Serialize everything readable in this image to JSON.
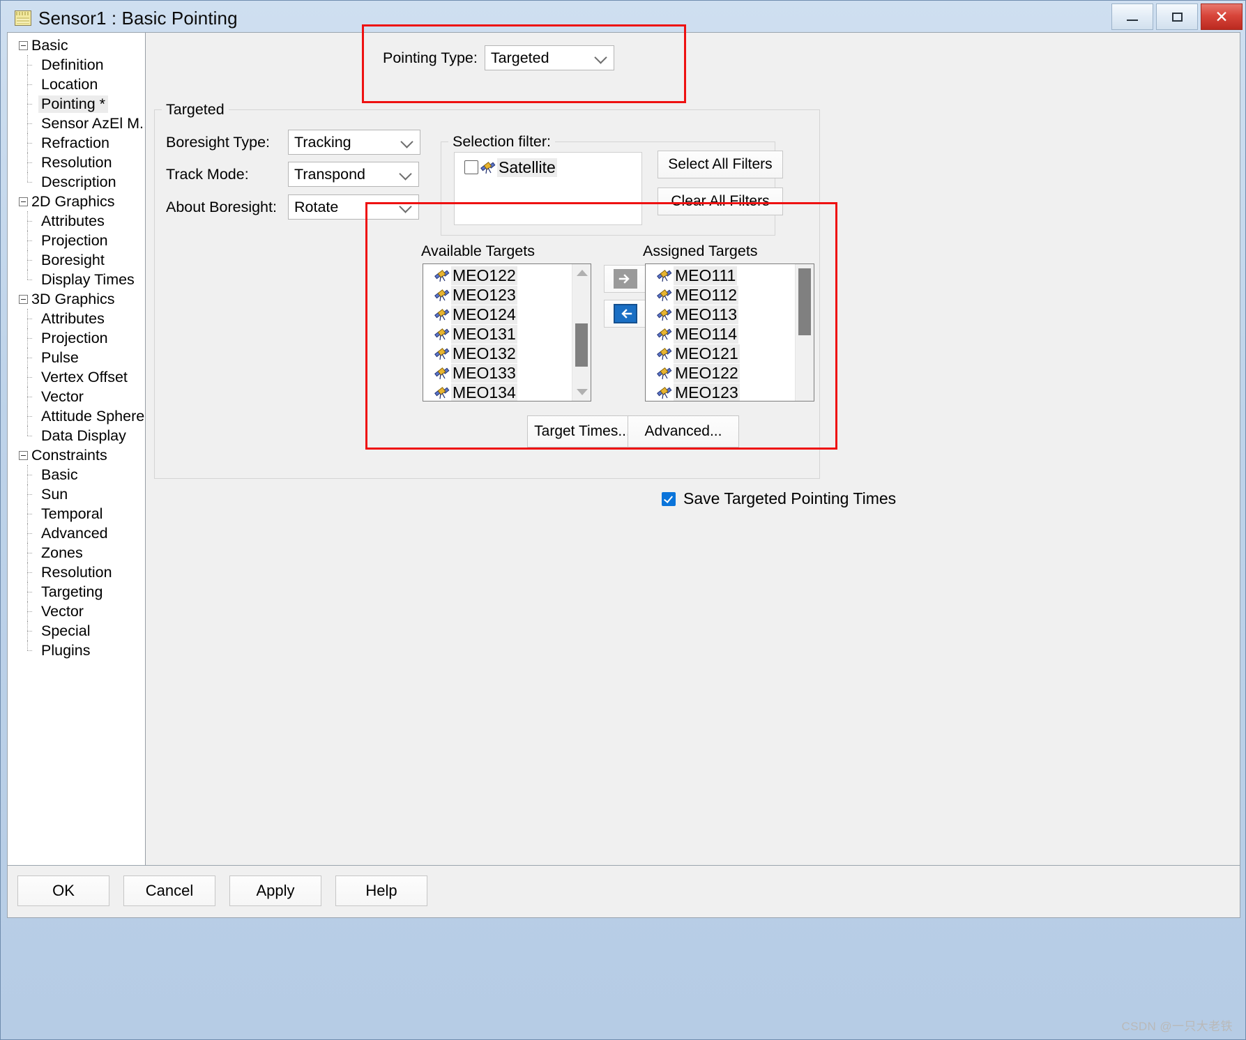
{
  "window": {
    "title": "Sensor1 : Basic Pointing",
    "icon": "properties-window-icon",
    "minimize_label": "–",
    "maximize_label": "□",
    "close_label": "✕"
  },
  "sidebar": {
    "groups": [
      {
        "label": "Basic",
        "items": [
          "Definition",
          "Location",
          "Pointing *",
          "Sensor AzEl M...",
          "Refraction",
          "Resolution",
          "Description"
        ],
        "selected": "Pointing *"
      },
      {
        "label": "2D Graphics",
        "items": [
          "Attributes",
          "Projection",
          "Boresight",
          "Display Times"
        ],
        "selected": ""
      },
      {
        "label": "3D Graphics",
        "items": [
          "Attributes",
          "Projection",
          "Pulse",
          "Vertex Offset",
          "Vector",
          "Attitude Sphere",
          "Data Display"
        ],
        "selected": ""
      },
      {
        "label": "Constraints",
        "items": [
          "Basic",
          "Sun",
          "Temporal",
          "Advanced",
          "Zones",
          "Resolution",
          "Targeting",
          "Vector",
          "Special",
          "Plugins"
        ],
        "selected": ""
      }
    ]
  },
  "main": {
    "pointing_type": {
      "label": "Pointing Type:",
      "value": "Targeted"
    },
    "targeted_group": {
      "title": "Targeted",
      "boresight_type": {
        "label": "Boresight Type:",
        "value": "Tracking"
      },
      "track_mode": {
        "label": "Track Mode:",
        "value": "Transpond"
      },
      "about_boresight": {
        "label": "About Boresight:",
        "value": "Rotate"
      }
    },
    "selection_filter": {
      "title": "Selection filter:",
      "items": [
        {
          "label": "Satellite",
          "checked": false,
          "icon": "satellite-icon",
          "highlighted": true
        }
      ],
      "select_all_label": "Select All Filters",
      "clear_all_label": "Clear All Filters"
    },
    "available_targets": {
      "caption": "Available Targets",
      "items": [
        "MEO122",
        "MEO123",
        "MEO124",
        "MEO131",
        "MEO132",
        "MEO133",
        "MEO134"
      ],
      "scroll_position": "middle"
    },
    "assigned_targets": {
      "caption": "Assigned Targets",
      "items": [
        "MEO111",
        "MEO112",
        "MEO113",
        "MEO114",
        "MEO121",
        "MEO122",
        "MEO123"
      ],
      "scroll_position": "top"
    },
    "move_buttons": {
      "assign_label": "→",
      "assign_enabled": false,
      "unassign_label": "←",
      "unassign_enabled": true
    },
    "target_times_label": "Target Times...",
    "advanced_label": "Advanced...",
    "save_pointing_times": {
      "label": "Save Targeted Pointing Times",
      "checked": true
    }
  },
  "footer": {
    "ok_label": "OK",
    "cancel_label": "Cancel",
    "apply_label": "Apply",
    "help_label": "Help"
  },
  "watermark": "CSDN @一只大老铁",
  "colors": {
    "annotation": "#ee1111",
    "accent_blue": "#0a74da",
    "window_chrome": "#b6cce5"
  }
}
